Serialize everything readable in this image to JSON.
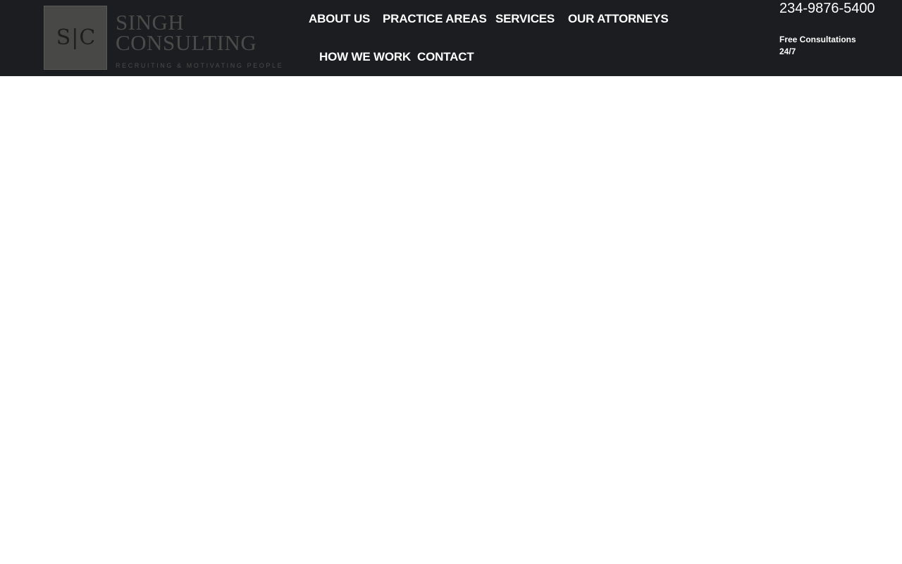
{
  "header": {
    "logo": {
      "monogram": "S|C",
      "name_line1": "SINGH",
      "name_line2": "CONSULTING",
      "tagline": "RECRUITING & MOTIVATING PEOPLE"
    },
    "nav": [
      {
        "label": "ABOUT US"
      },
      {
        "label": "PRACTICE AREAS"
      },
      {
        "label": "SERVICES"
      },
      {
        "label": "OUR ATTORNEYS"
      },
      {
        "label": "HOW WE WORK"
      },
      {
        "label": "CONTACT"
      }
    ],
    "phone": "234-9876-5400",
    "consultation_note": "Free Consultations 24/7"
  },
  "colors": {
    "header_background": "#1c1d21",
    "nav_text": "#ffffff",
    "logo_text": "#4b4b49",
    "page_background": "#ffffff"
  }
}
